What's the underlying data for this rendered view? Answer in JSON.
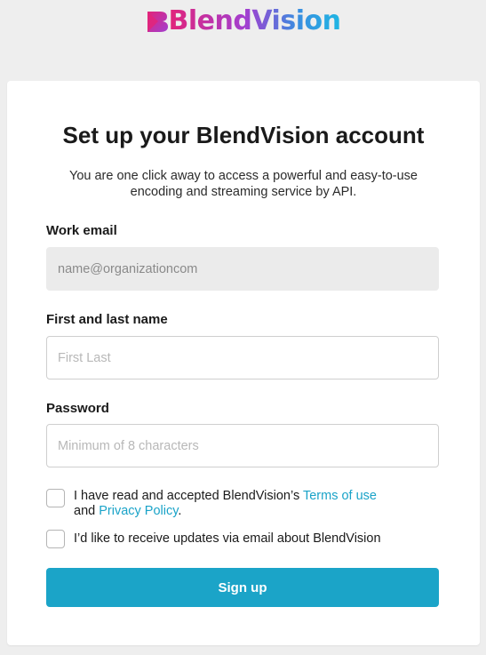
{
  "brand": {
    "logo_text": "BlendVision",
    "logo_icon": "blendvision-logo-icon"
  },
  "form": {
    "title": "Set up your BlendVision account",
    "subtitle": "You are one click away to access a powerful and easy-to-use encoding and streaming service by API.",
    "work_email": {
      "label": "Work email",
      "value": "name@organizationcom"
    },
    "name": {
      "label": "First and last name",
      "placeholder": "First Last"
    },
    "password": {
      "label": "Password",
      "placeholder": "Minimum of 8 characters"
    },
    "terms": {
      "text_before": "I have read and accepted BlendVision’s ",
      "terms_link": "Terms of use",
      "text_and": "and ",
      "privacy_link": "Privacy Policy",
      "text_after": "."
    },
    "updates": {
      "text": "I’d like to receive updates via email about BlendVision"
    },
    "submit_label": "Sign up"
  },
  "colors": {
    "accent": "#1ba4c8",
    "link": "#1aa3c8",
    "background": "#eeeeee",
    "card": "#ffffff",
    "logo_gradient_start": "#e2247a",
    "logo_gradient_end": "#1fb6e3"
  }
}
